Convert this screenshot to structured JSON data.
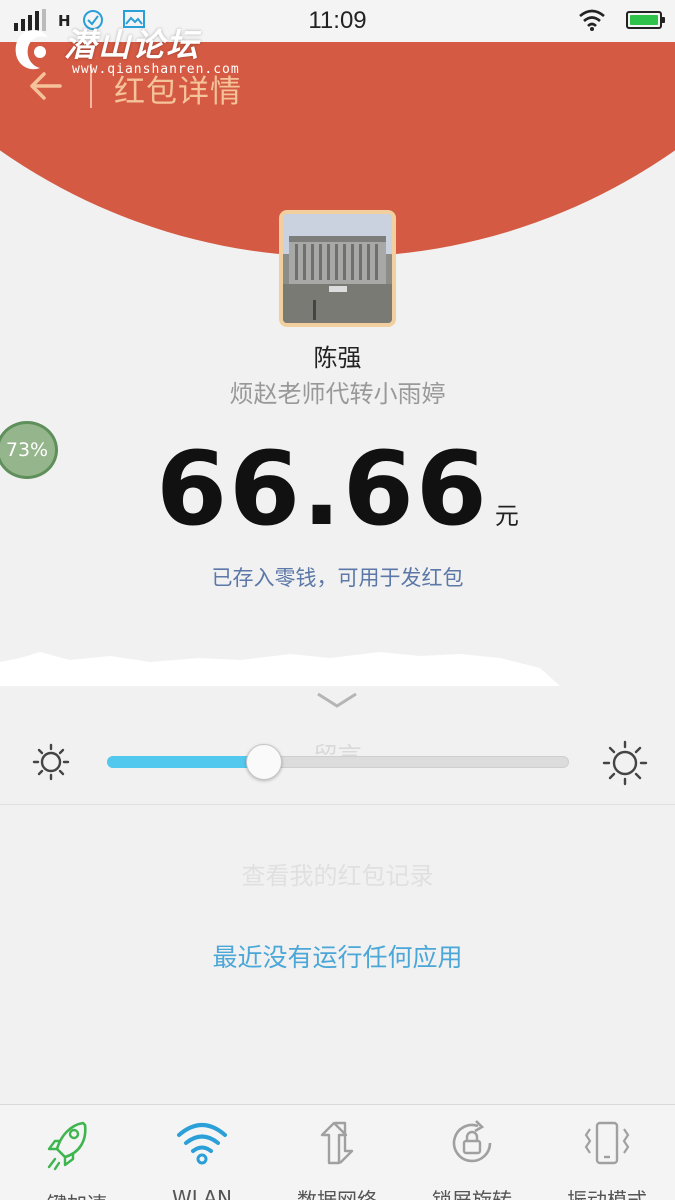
{
  "status_bar": {
    "network_type": "H",
    "time": "11:09"
  },
  "header": {
    "title": "红包详情"
  },
  "watermark": {
    "name": "潜山论坛",
    "url": "www.qianshanren.com"
  },
  "packet": {
    "sender": "陈强",
    "message": "烦赵老师代转小雨婷",
    "amount": "66.66",
    "unit": "元",
    "stored_note": "已存入零钱，可用于发红包"
  },
  "floating_badge": {
    "percent": "73%"
  },
  "panel": {
    "leave_message": "留言",
    "view_records": "查看我的红包记录",
    "brightness_level": 0.34,
    "no_apps_text": "最近没有运行任何应用"
  },
  "toggles": [
    {
      "label": "一键加速",
      "icon": "rocket-icon",
      "color": "#3fb54f"
    },
    {
      "label": "WLAN",
      "icon": "wifi-icon",
      "color": "#2b9fd8"
    },
    {
      "label": "数据网络",
      "icon": "data-network-icon",
      "color": "#9a9a9a"
    },
    {
      "label": "锁屏旋转",
      "icon": "rotation-lock-icon",
      "color": "#9a9a9a"
    },
    {
      "label": "振动模式",
      "icon": "vibrate-icon",
      "color": "#9a9a9a"
    }
  ],
  "colors": {
    "header_red": "#d55a43",
    "title_gold": "#f4c39a",
    "accent_blue": "#52c8ee",
    "link_blue": "#4ba7d7"
  }
}
